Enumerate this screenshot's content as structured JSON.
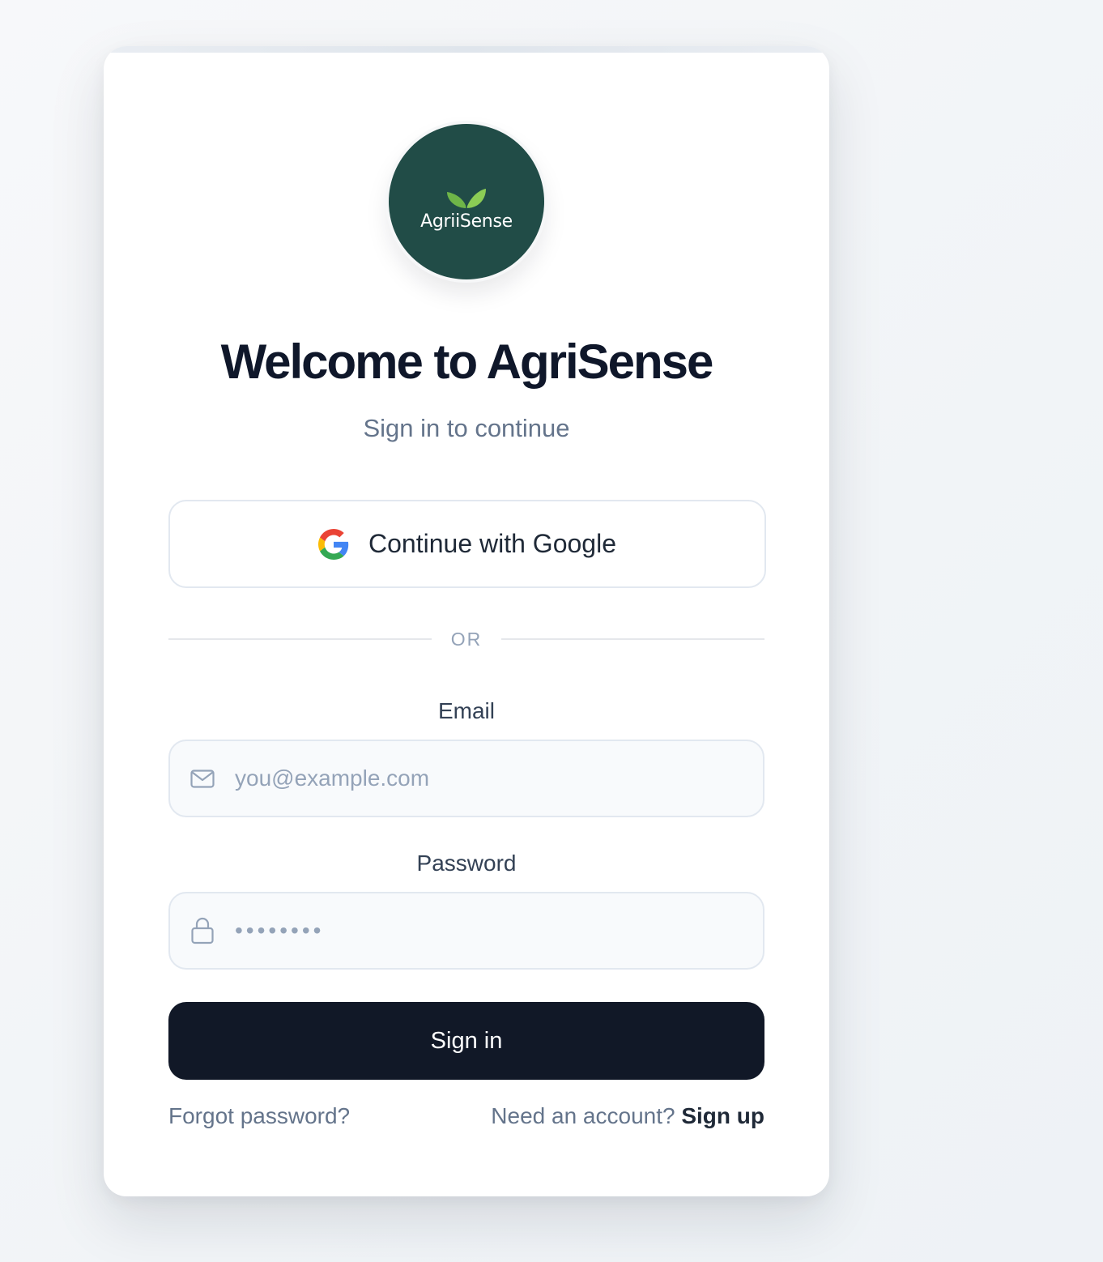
{
  "brand": {
    "logo_text": "AgriiSense",
    "logo_bg_color": "#214c47",
    "leaf_color": "#7cc04b"
  },
  "header": {
    "title": "Welcome to AgriSense",
    "subtitle": "Sign in to continue"
  },
  "google": {
    "label": "Continue with Google",
    "icon": "google-g-icon"
  },
  "divider": {
    "text": "OR"
  },
  "email": {
    "label": "Email",
    "placeholder": "you@example.com",
    "icon": "mail-icon"
  },
  "password": {
    "label": "Password",
    "placeholder": "••••••••",
    "icon": "lock-icon"
  },
  "actions": {
    "sign_in": "Sign in",
    "forgot_password": "Forgot password?",
    "need_account": "Need an account?",
    "sign_up": "Sign up"
  },
  "colors": {
    "primary_button": "#111827",
    "muted_text": "#64748b",
    "border": "#e2e8f0"
  }
}
